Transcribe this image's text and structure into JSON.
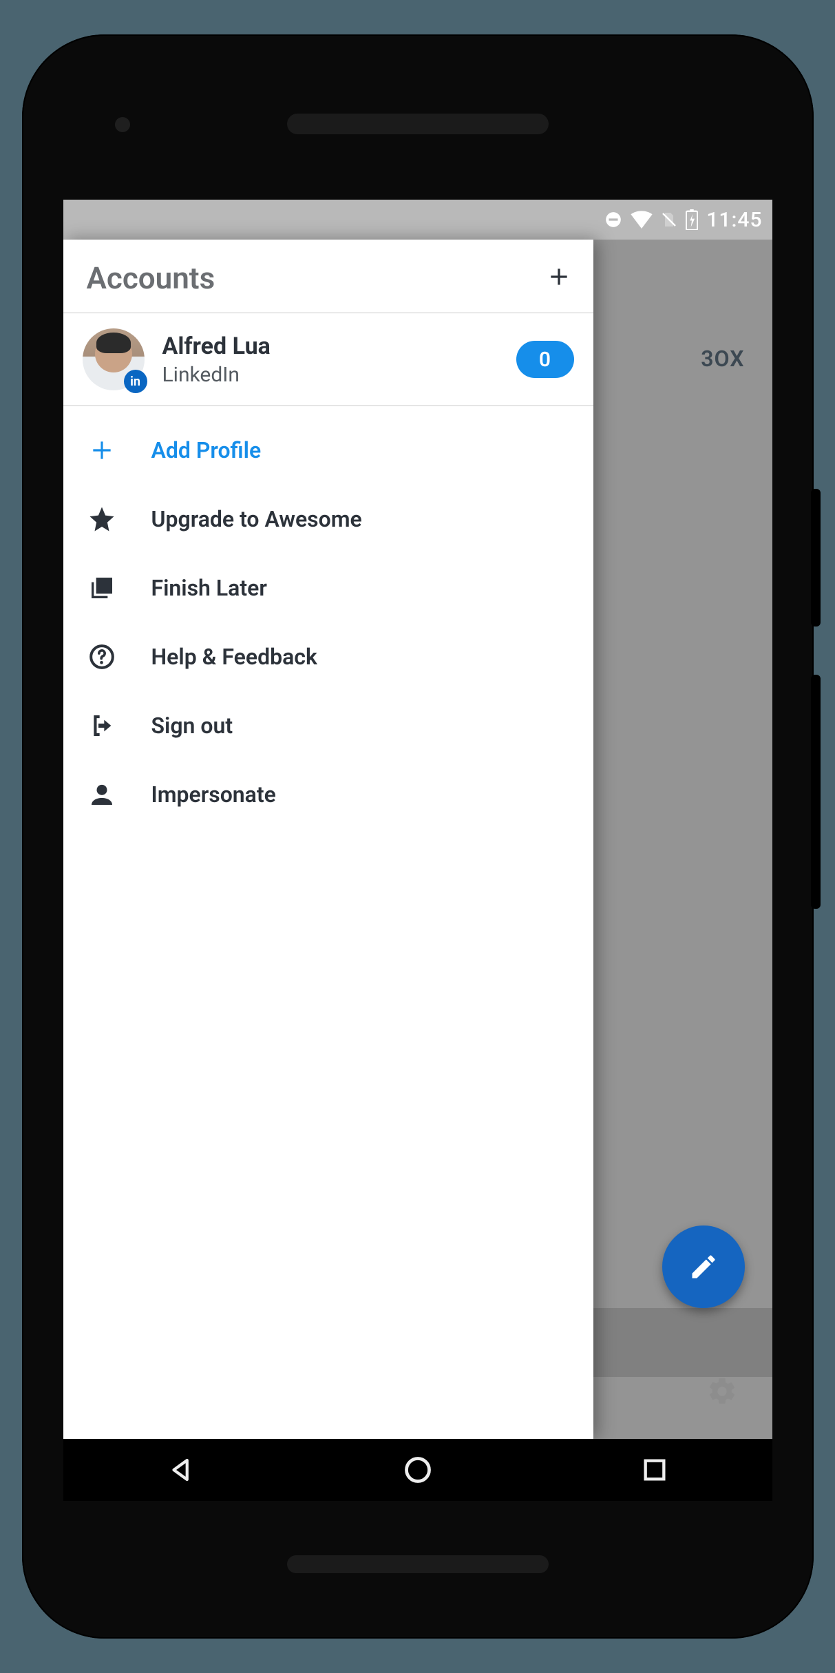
{
  "statusbar": {
    "time": "11:45"
  },
  "drawer": {
    "title": "Accounts",
    "account": {
      "name": "Alfred Lua",
      "network": "LinkedIn",
      "network_badge": "in",
      "count": "0"
    },
    "menu": {
      "add_profile": "Add Profile",
      "upgrade": "Upgrade to Awesome",
      "finish_later": "Finish Later",
      "help": "Help & Feedback",
      "sign_out": "Sign out",
      "impersonate": "Impersonate"
    }
  },
  "background": {
    "tab_fragment": "3OX"
  }
}
